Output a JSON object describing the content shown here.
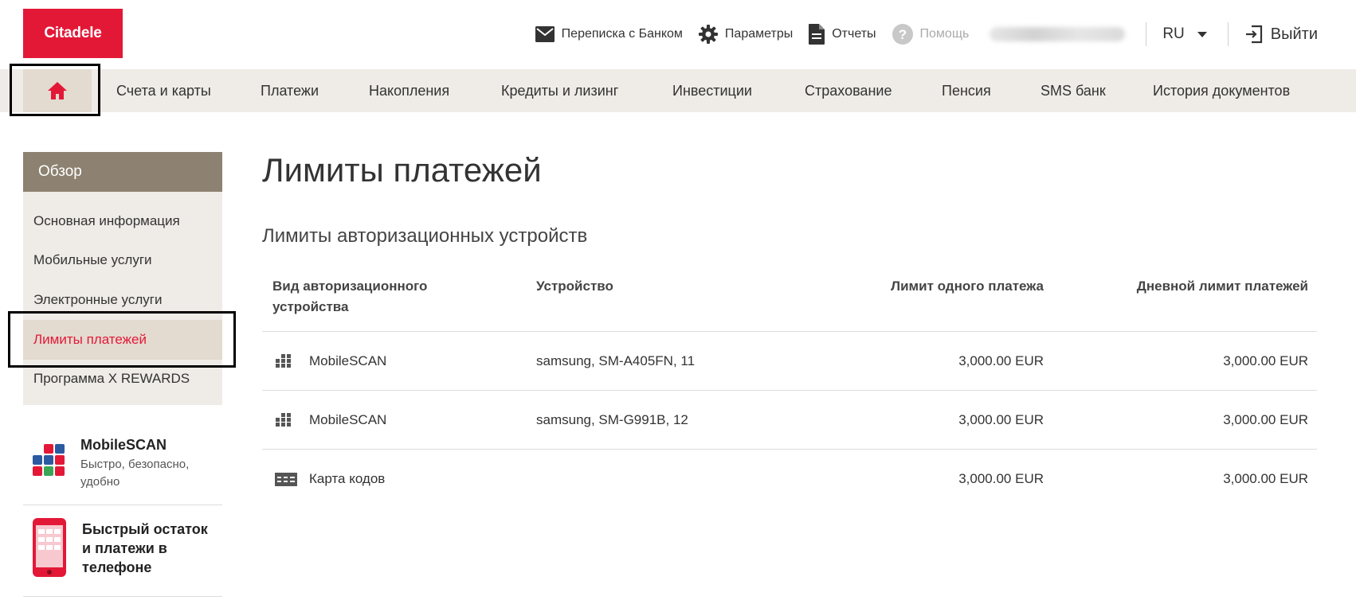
{
  "header": {
    "logo": "Citadele",
    "links": {
      "messages": "Переписка с Банком",
      "settings": "Параметры",
      "reports": "Отчеты",
      "help": "Помощь"
    },
    "language": "RU",
    "logout": "Выйти"
  },
  "main_nav": {
    "items": [
      "Счета и карты",
      "Платежи",
      "Накопления",
      "Кредиты и лизинг",
      "Инвестиции",
      "Страхование",
      "Пенсия",
      "SMS банк",
      "История документов"
    ]
  },
  "sidebar": {
    "header": "Обзор",
    "items": [
      "Основная информация",
      "Мобильные услуги",
      "Электронные услуги",
      "Лимиты платежей",
      "Программа X REWARDS"
    ],
    "active_index": 3,
    "promos": [
      {
        "title": "MobileSCAN",
        "subtitle_lines": [
          "Быстро, безопасно,",
          "удобно"
        ]
      },
      {
        "title_lines": [
          "Быстрый остаток",
          "и платежи в",
          "телефоне"
        ]
      }
    ]
  },
  "content": {
    "title": "Лимиты платежей",
    "section_title": "Лимиты авторизационных устройств",
    "table": {
      "headers": {
        "type_lines": [
          "Вид авторизационного",
          "устройства"
        ],
        "device": "Устройство",
        "single_limit": "Лимит одного платежа",
        "daily_limit": "Дневной лимит платежей"
      },
      "rows": [
        {
          "icon": "mobilescan-grid-icon",
          "type": "MobileSCAN",
          "device": "samsung, SM-A405FN, 11",
          "single_limit": "3,000.00 EUR",
          "daily_limit": "3,000.00 EUR"
        },
        {
          "icon": "mobilescan-grid-icon",
          "type": "MobileSCAN",
          "device": "samsung, SM-G991B, 12",
          "single_limit": "3,000.00 EUR",
          "daily_limit": "3,000.00 EUR"
        },
        {
          "icon": "code-card-icon",
          "type": "Карта кодов",
          "device": "",
          "single_limit": "3,000.00 EUR",
          "daily_limit": "3,000.00 EUR"
        }
      ]
    }
  },
  "colors": {
    "brand_red": "#e31837",
    "nav_bg": "#efebe7",
    "nav_active": "#e3dad0",
    "sidebar_header": "#8d8271"
  }
}
